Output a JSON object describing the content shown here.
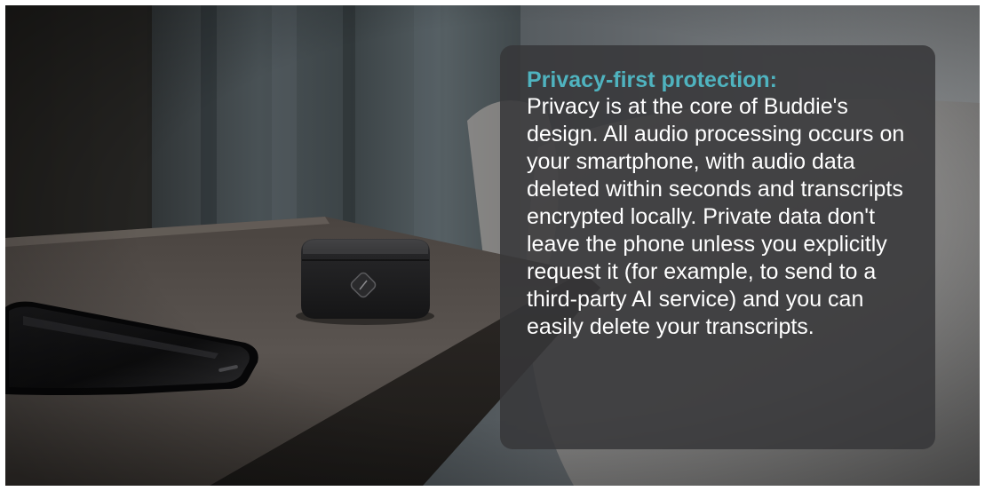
{
  "colors": {
    "heading": "#4fb3bf",
    "body_text": "#ffffff",
    "card_background": "rgba(55,55,57,0.86)"
  },
  "caption": {
    "heading": "Privacy-first protection:",
    "body": "Privacy is at the core of Buddie's design. All audio processing occurs on your smartphone, with audio data deleted within seconds and transcripts encrypted locally. Private data don't leave the phone unless you explicitly request it (for example, to send to a third-party AI service) and you can easily delete your transcripts."
  },
  "scene": {
    "objects": [
      "smartphone",
      "buddie-charging-case",
      "bedside-table",
      "bed-pillow",
      "curtain"
    ]
  }
}
